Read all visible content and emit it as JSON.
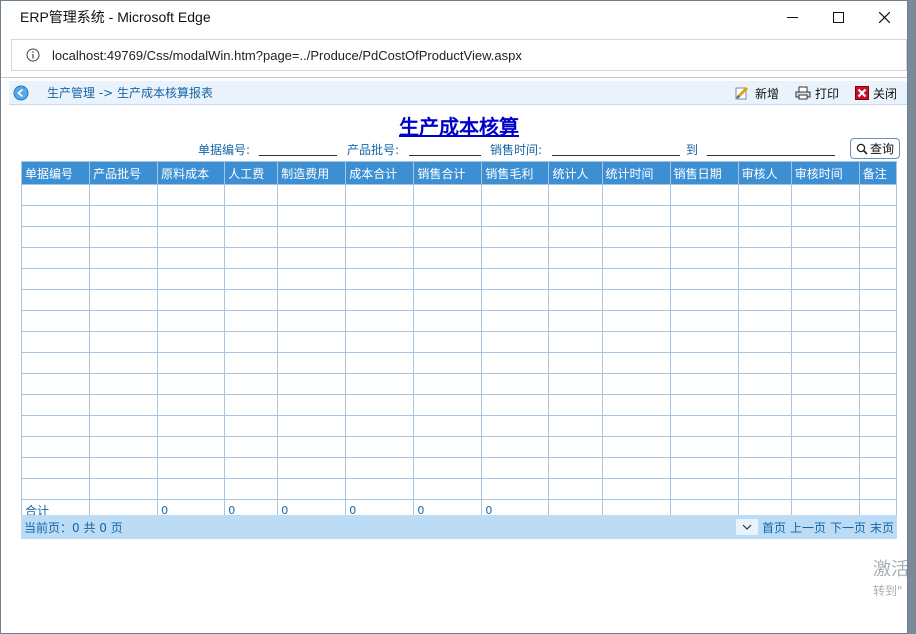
{
  "window": {
    "title": "ERP管理系统 - Microsoft Edge"
  },
  "address": {
    "url": "localhost:49769/Css/modalWin.htm?page=../Produce/PdCostOfProductView.aspx"
  },
  "toolbar": {
    "breadcrumb": "生产管理 -> 生产成本核算报表",
    "add_label": "新增",
    "print_label": "打印",
    "close_label": "关闭"
  },
  "page": {
    "title": "生产成本核算"
  },
  "filters": {
    "doc_no_label": "单据编号:",
    "batch_label": "产品批号:",
    "sale_time_label": "销售时间:",
    "to_label": "到",
    "query_label": "查询"
  },
  "grid": {
    "columns": [
      "单据编号",
      "产品批号",
      "原料成本",
      "人工费",
      "制造费用",
      "成本合计",
      "销售合计",
      "销售毛利",
      "统计人",
      "统计时间",
      "销售日期",
      "审核人",
      "审核时间",
      "备注"
    ],
    "empty_rows": 15,
    "summary": {
      "label": "合计",
      "values": [
        "",
        "0",
        "0",
        "0",
        "0",
        "0",
        "0",
        "",
        "",
        "",
        "",
        "",
        ""
      ]
    }
  },
  "pager": {
    "info": "当前页：0 共 0 页",
    "first": "首页",
    "prev": "上一页",
    "next": "下一页",
    "last": "末页"
  },
  "watermark": {
    "line1": "激活",
    "line2": "转到\""
  },
  "colors": {
    "header_bg": "#3d8fd4",
    "pager_bg": "#bcdcf5",
    "title": "#0000cc",
    "link": "#1565a8"
  }
}
